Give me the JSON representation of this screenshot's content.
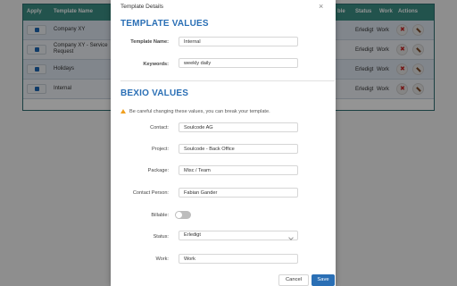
{
  "background_table": {
    "headers": {
      "apply": "Apply",
      "template_name": "Template Name",
      "billable_partial": "ble",
      "status": "Status",
      "work": "Work",
      "actions": "Actions"
    },
    "rows": [
      {
        "name": "Company XY",
        "status": "Erledigt",
        "work": "Work"
      },
      {
        "name": "Company XY - Service Request",
        "status": "Erledigt",
        "work": "Work"
      },
      {
        "name": "Holidays",
        "status": "Erledigt",
        "work": "Work"
      },
      {
        "name": "Internal",
        "status": "Erledigt",
        "work": "Work"
      }
    ]
  },
  "modal": {
    "title": "Template Details",
    "close_glyph": "×",
    "template_section": {
      "heading": "TEMPLATE VALUES",
      "name_label": "Template Name:",
      "name_value": "Internal",
      "keywords_label": "Keywords:",
      "keywords_value": "weekly daily"
    },
    "bexio_section": {
      "heading": "BEXIO VALUES",
      "warning": "Be careful changing these values, you can break your template.",
      "contact_label": "Contact:",
      "contact_value": "Soulcode AG",
      "project_label": "Project:",
      "project_value": "Soulcode - Back Office",
      "package_label": "Package:",
      "package_value": "Misc / Team",
      "contact_person_label": "Contact Person:",
      "contact_person_value": "Fabian Gander",
      "billable_label": "Billable:",
      "billable_on": false,
      "status_label": "Status:",
      "status_value": "Erledigt",
      "work_label": "Work:",
      "work_value": "Work"
    },
    "buttons": {
      "cancel": "Cancel",
      "save": "Save"
    }
  },
  "colors": {
    "header_bg": "#3b8f86",
    "accent_blue": "#2a6fb5",
    "delete_red": "#c62828",
    "warning_orange": "#f0a020"
  }
}
